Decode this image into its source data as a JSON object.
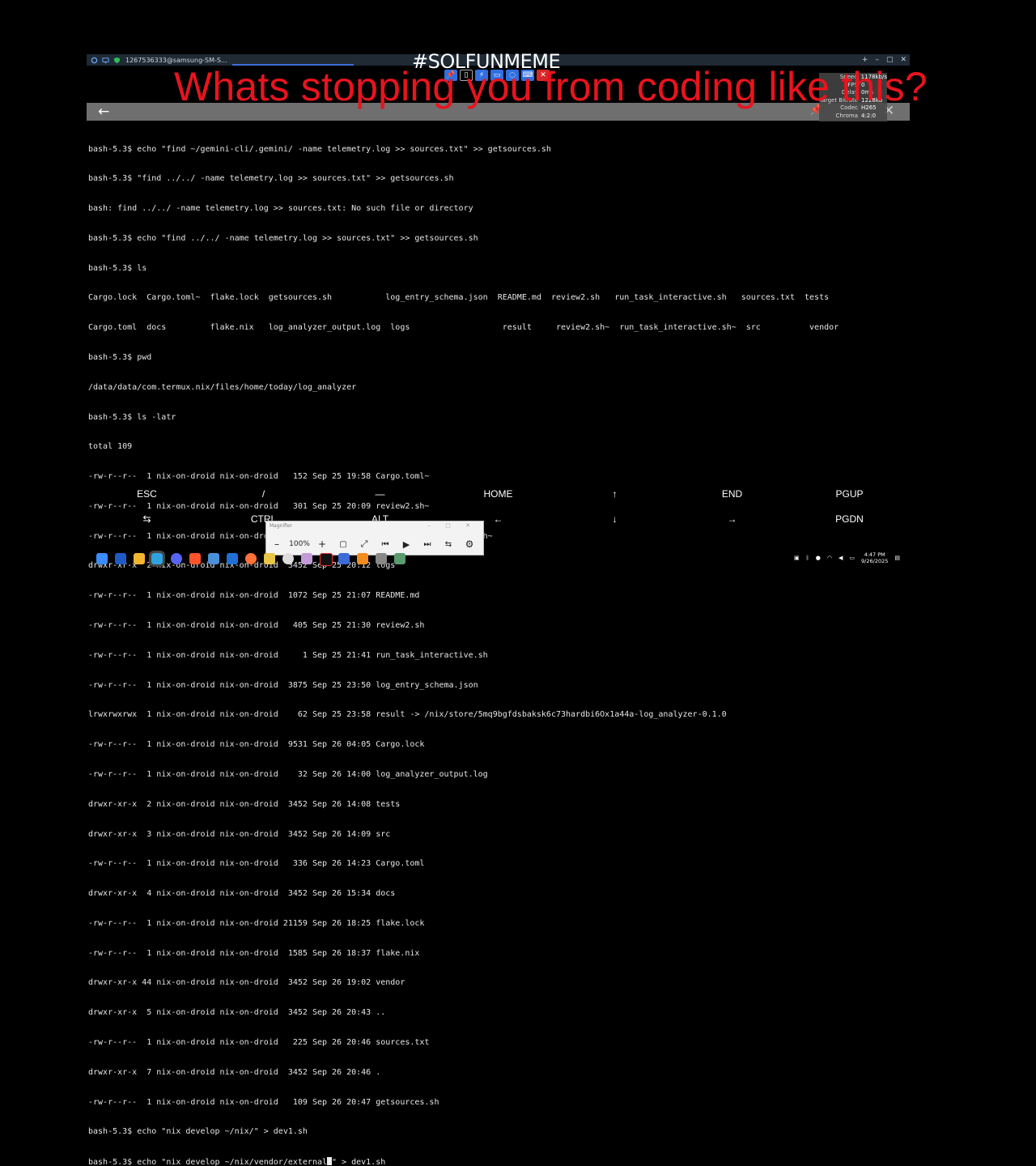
{
  "window": {
    "title": "1267536333@samsung-SM-S...",
    "controls": [
      "+",
      "–",
      "▢",
      "✕"
    ]
  },
  "overlay": {
    "hashtag": "#SOLFUNMEME",
    "headline": "Whats stopping you from coding like this?"
  },
  "stats": [
    {
      "k": "Speed",
      "v": "1178kb/s"
    },
    {
      "k": "FPS",
      "v": "0"
    },
    {
      "k": "Delay",
      "v": "0ms"
    },
    {
      "k": "Target Bitrate",
      "v": "1228kb"
    },
    {
      "k": "Codec",
      "v": "H265"
    },
    {
      "k": "Chroma",
      "v": "4:2:0"
    }
  ],
  "terminal": {
    "lines": [
      "bash-5.3$ echo \"find ~/gemini-cli/.gemini/ -name telemetry.log >> sources.txt\" >> getsources.sh",
      "bash-5.3$ \"find ../../ -name telemetry.log >> sources.txt\" >> getsources.sh",
      "bash: find ../../ -name telemetry.log >> sources.txt: No such file or directory",
      "bash-5.3$ echo \"find ../../ -name telemetry.log >> sources.txt\" >> getsources.sh",
      "bash-5.3$ ls",
      "Cargo.lock  Cargo.toml~  flake.lock  getsources.sh           log_entry_schema.json  README.md  review2.sh   run_task_interactive.sh   sources.txt  tests",
      "Cargo.toml  docs         flake.nix   log_analyzer_output.log  logs                   result     review2.sh~  run_task_interactive.sh~  src          vendor",
      "bash-5.3$ pwd",
      "/data/data/com.termux.nix/files/home/today/log_analyzer",
      "bash-5.3$ ls -latr",
      "total 109",
      "-rw-r--r--  1 nix-on-droid nix-on-droid   152 Sep 25 19:58 Cargo.toml~",
      "-rw-r--r--  1 nix-on-droid nix-on-droid   301 Sep 25 20:09 review2.sh~",
      "-rw-r--r--  1 nix-on-droid nix-on-droid   340 Sep 25 20:09 run_task_interactive.sh~",
      "drwxr-xr-x  2 nix-on-droid nix-on-droid  3452 Sep 25 20:12 logs",
      "-rw-r--r--  1 nix-on-droid nix-on-droid  1072 Sep 25 21:07 README.md",
      "-rw-r--r--  1 nix-on-droid nix-on-droid   405 Sep 25 21:30 review2.sh",
      "-rw-r--r--  1 nix-on-droid nix-on-droid     1 Sep 25 21:41 run_task_interactive.sh",
      "-rw-r--r--  1 nix-on-droid nix-on-droid  3875 Sep 25 23:50 log_entry_schema.json",
      "lrwxrwxrwx  1 nix-on-droid nix-on-droid    62 Sep 25 23:58 result -> /nix/store/5mq9bgfdsbaksk6c73hardbi6Ox1a44a-log_analyzer-0.1.0",
      "-rw-r--r--  1 nix-on-droid nix-on-droid  9531 Sep 26 04:05 Cargo.lock",
      "-rw-r--r--  1 nix-on-droid nix-on-droid    32 Sep 26 14:00 log_analyzer_output.log",
      "drwxr-xr-x  2 nix-on-droid nix-on-droid  3452 Sep 26 14:08 tests",
      "drwxr-xr-x  3 nix-on-droid nix-on-droid  3452 Sep 26 14:09 src",
      "-rw-r--r--  1 nix-on-droid nix-on-droid   336 Sep 26 14:23 Cargo.toml",
      "drwxr-xr-x  4 nix-on-droid nix-on-droid  3452 Sep 26 15:34 docs",
      "-rw-r--r--  1 nix-on-droid nix-on-droid 21159 Sep 26 18:25 flake.lock",
      "-rw-r--r--  1 nix-on-droid nix-on-droid  1585 Sep 26 18:37 flake.nix",
      "drwxr-xr-x 44 nix-on-droid nix-on-droid  3452 Sep 26 19:02 vendor",
      "drwxr-xr-x  5 nix-on-droid nix-on-droid  3452 Sep 26 20:43 ..",
      "-rw-r--r--  1 nix-on-droid nix-on-droid   225 Sep 26 20:46 sources.txt",
      "drwxr-xr-x  7 nix-on-droid nix-on-droid  3452 Sep 26 20:46 .",
      "-rw-r--r--  1 nix-on-droid nix-on-droid   109 Sep 26 20:47 getsources.sh",
      "bash-5.3$ echo \"nix develop ~/nix/\" > dev1.sh"
    ],
    "current_input_before": "bash-5.3$ echo \"nix develop ~/nix/vendor/external",
    "current_input_after": "\" > dev1.sh"
  },
  "extra_keys": {
    "row1": [
      "ESC",
      "/",
      "—",
      "HOME",
      "↑",
      "END",
      "PGUP"
    ],
    "row2": [
      "⇆",
      "CTRL",
      "ALT",
      "←",
      "↓",
      "→",
      "PGDN"
    ]
  },
  "magnifier": {
    "title": "Magnifier",
    "zoom_out": "–",
    "zoom": "100%",
    "zoom_in": "+"
  },
  "taskbar": {
    "time": "4:47 PM",
    "date": "9/26/2025"
  },
  "colors": {
    "headline": "#e8141e",
    "appbar": "#6f6f6f",
    "titlebar": "#1f2a35",
    "floatbar": "#2f6fe0"
  }
}
